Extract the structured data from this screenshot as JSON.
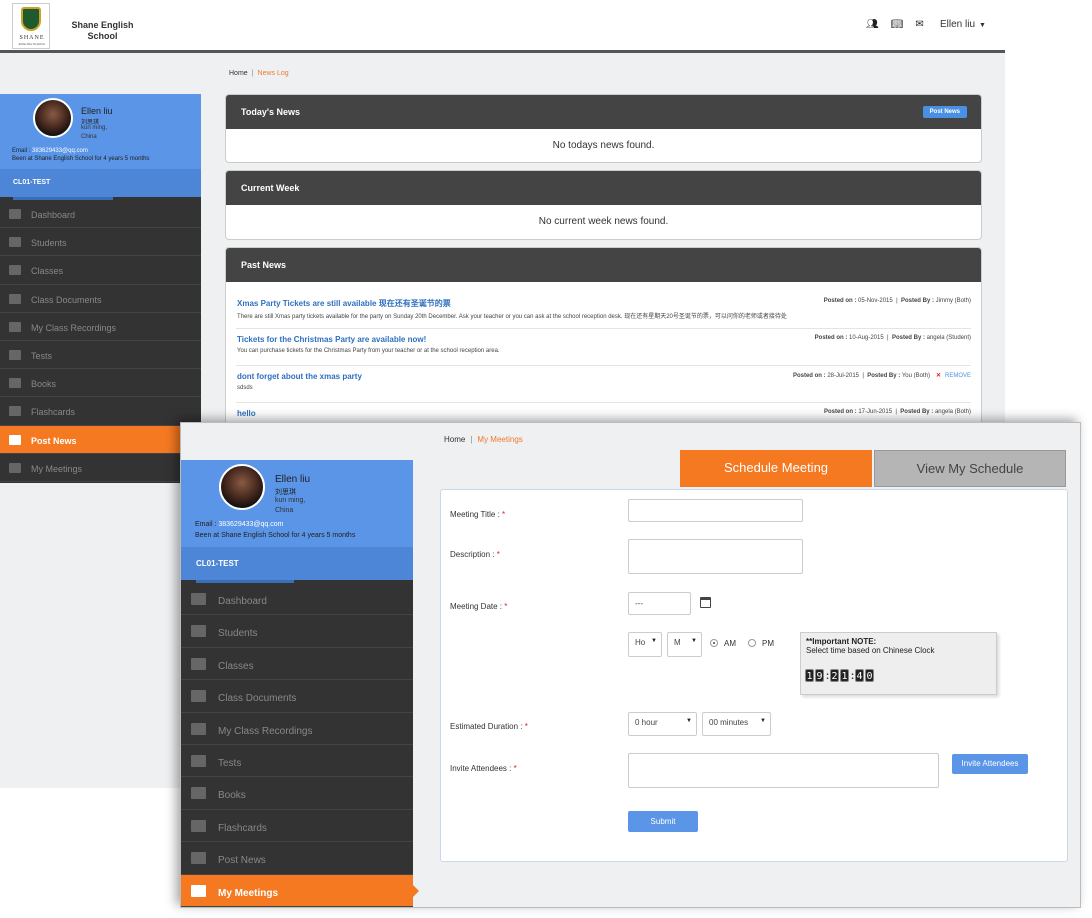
{
  "back_screen": {
    "header": {
      "logo_text": "SHANE",
      "logo_subtext": "ENGLISH SCHOOL",
      "school_name": "Shane English School",
      "user_name": "Ellen liu"
    },
    "breadcrumb": {
      "home": "Home",
      "separator": "|",
      "current": "News Log"
    },
    "profile": {
      "name": "Ellen liu",
      "chinese_name": "刘思琪",
      "city": "kun ming,",
      "country": "China",
      "email_label": "Email :",
      "email": "383629433@qq.com",
      "tenure": "Been at Shane English School for 4 years 5 months",
      "class_code": "CL01-TEST"
    },
    "nav": [
      {
        "label": "Dashboard",
        "icon": "dashboard-icon"
      },
      {
        "label": "Students",
        "icon": "student-icon"
      },
      {
        "label": "Classes",
        "icon": "classes-icon"
      },
      {
        "label": "Class Documents",
        "icon": "document-icon"
      },
      {
        "label": "My Class Recordings",
        "icon": "recording-icon"
      },
      {
        "label": "Tests",
        "icon": "tests-icon"
      },
      {
        "label": "Books",
        "icon": "book-icon"
      },
      {
        "label": "Flashcards",
        "icon": "flashcard-icon"
      },
      {
        "label": "Post News",
        "icon": "news-icon",
        "active": true
      },
      {
        "label": "My Meetings",
        "icon": "meetings-icon"
      }
    ],
    "panels": {
      "today": {
        "title": "Today's News",
        "button": "Post News",
        "empty": "No todays news found."
      },
      "week": {
        "title": "Current Week",
        "empty": "No current week news found."
      },
      "past": {
        "title": "Past News"
      }
    },
    "past_news": [
      {
        "title": "Xmas Party Tickets are still available 现在还有圣诞节的票",
        "desc": "There are still Xmas party tickets available for the party on Sunday 20th December. Ask your teacher or you can ask at the school reception desk. 现在还有星期天20号圣诞节的票，可以问你的老师或者接待处",
        "posted_on_label": "Posted on :",
        "posted_on": "05-Nov-2015",
        "posted_by_label": "Posted By :",
        "posted_by": "Jimmy (Both)"
      },
      {
        "title": "Tickets for the Christmas Party are available now!",
        "desc": "You can purchase tickets for the Christmas Party from your teacher or at the school reception area.",
        "posted_on_label": "Posted on :",
        "posted_on": "10-Aug-2015",
        "posted_by_label": "Posted By :",
        "posted_by": "angela (Student)"
      },
      {
        "title": "dont forget about the xmas party",
        "desc": "sdsds",
        "posted_on_label": "Posted on :",
        "posted_on": "28-Jul-2015",
        "posted_by_label": "Posted By :",
        "posted_by": "You (Both)",
        "remove": "REMOVE"
      },
      {
        "title": "hello",
        "desc": "",
        "posted_on_label": "Posted on :",
        "posted_on": "17-Jun-2015",
        "posted_by_label": "Posted By :",
        "posted_by": "angela (Both)"
      }
    ]
  },
  "front_screen": {
    "breadcrumb": {
      "home": "Home",
      "separator": "|",
      "current": "My Meetings"
    },
    "profile": {
      "name": "Ellen liu",
      "chinese_name": "刘思琪",
      "city": "kun ming,",
      "country": "China",
      "email_label": "Email :",
      "email": "383629433@qq.com",
      "tenure": "Been at Shane English School for 4 years 5 months",
      "class_code": "CL01-TEST"
    },
    "nav": [
      {
        "label": "Dashboard",
        "icon": "dashboard-icon"
      },
      {
        "label": "Students",
        "icon": "student-icon"
      },
      {
        "label": "Classes",
        "icon": "classes-icon"
      },
      {
        "label": "Class Documents",
        "icon": "document-icon"
      },
      {
        "label": "My Class Recordings",
        "icon": "recording-icon"
      },
      {
        "label": "Tests",
        "icon": "tests-icon"
      },
      {
        "label": "Books",
        "icon": "book-icon"
      },
      {
        "label": "Flashcards",
        "icon": "flashcard-icon"
      },
      {
        "label": "Post News",
        "icon": "news-icon"
      },
      {
        "label": "My Meetings",
        "icon": "meetings-icon",
        "active": true
      }
    ],
    "tabs": {
      "schedule": "Schedule Meeting",
      "view": "View My Schedule"
    },
    "form": {
      "title_label": "Meeting Title :",
      "desc_label": "Description :",
      "date_label": "Meeting Date :",
      "date_value": "---",
      "hour_value": "Ho",
      "minute_value": "M",
      "am_label": "AM",
      "pm_label": "PM",
      "ampm_selected": "AM",
      "note_title": "**Important NOTE:",
      "note_text": "Select time based on Chinese Clock",
      "clock": {
        "h1": "1",
        "h2": "9",
        "m1": "2",
        "m2": "1",
        "s1": "4",
        "s2": "0"
      },
      "duration_label": "Estimated Duration :",
      "duration_hour": "0 hour",
      "duration_min": "00 minutes",
      "invite_label": "Invite Attendees :",
      "invite_button": "Invite Attendees",
      "submit": "Submit",
      "required_mark": "*"
    }
  }
}
